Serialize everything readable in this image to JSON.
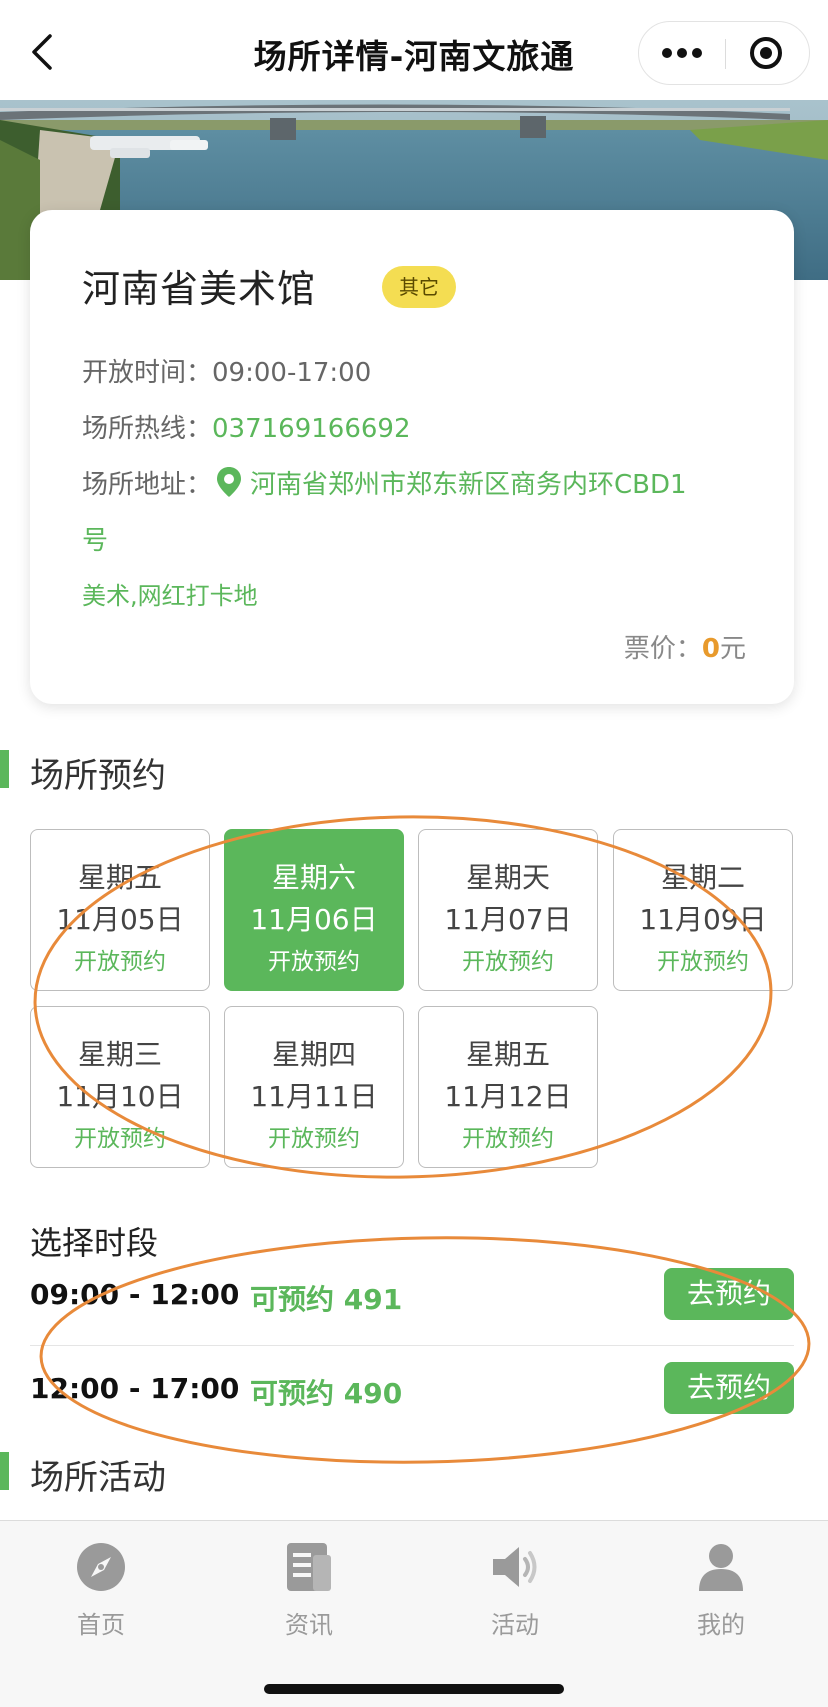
{
  "nav": {
    "title": "场所详情-河南文旅通",
    "more_icon": "more-dots-icon",
    "close_icon": "target-circle-icon"
  },
  "banner": {
    "slide_count": 5,
    "active_slide": 5
  },
  "venue": {
    "name": "河南省美术馆",
    "tag": "其它",
    "hours_label": "开放时间：",
    "hours_value": "09:00-17:00",
    "hotline_label": "场所热线：",
    "hotline_value": "037169166692",
    "address_label": "场所地址：",
    "address_value_line1": "河南省郑州市郑东新区商务内环CBD1",
    "address_value_line2": "号",
    "categories": "美术,网红打卡地",
    "price_label": "票价：",
    "price_value": "0",
    "price_unit": "元"
  },
  "booking": {
    "section_title": "场所预约",
    "dates": [
      {
        "weekday": "星期五",
        "date": "11月05日",
        "status": "开放预约",
        "selected": false
      },
      {
        "weekday": "星期六",
        "date": "11月06日",
        "status": "开放预约",
        "selected": true
      },
      {
        "weekday": "星期天",
        "date": "11月07日",
        "status": "开放预约",
        "selected": false
      },
      {
        "weekday": "星期二",
        "date": "11月09日",
        "status": "开放预约",
        "selected": false
      },
      {
        "weekday": "星期三",
        "date": "11月10日",
        "status": "开放预约",
        "selected": false
      },
      {
        "weekday": "星期四",
        "date": "11月11日",
        "status": "开放预约",
        "selected": false
      },
      {
        "weekday": "星期五",
        "date": "11月12日",
        "status": "开放预约",
        "selected": false
      }
    ],
    "slot_title": "选择时段",
    "slots": [
      {
        "time": "09:00 - 12:00",
        "available": "可预约 491",
        "button": "去预约"
      },
      {
        "time": "12:00 - 17:00",
        "available": "可预约 490",
        "button": "去预约"
      }
    ]
  },
  "activities": {
    "section_title": "场所活动"
  },
  "tabbar": {
    "items": [
      {
        "label": "首页",
        "icon": "compass-icon"
      },
      {
        "label": "资讯",
        "icon": "news-icon"
      },
      {
        "label": "活动",
        "icon": "speaker-icon"
      },
      {
        "label": "我的",
        "icon": "user-icon"
      }
    ]
  },
  "colors": {
    "accent": "#5bb75b",
    "tag_bg": "#f4dd52",
    "price": "#e89a2c",
    "annotation": "#e88a3a"
  }
}
